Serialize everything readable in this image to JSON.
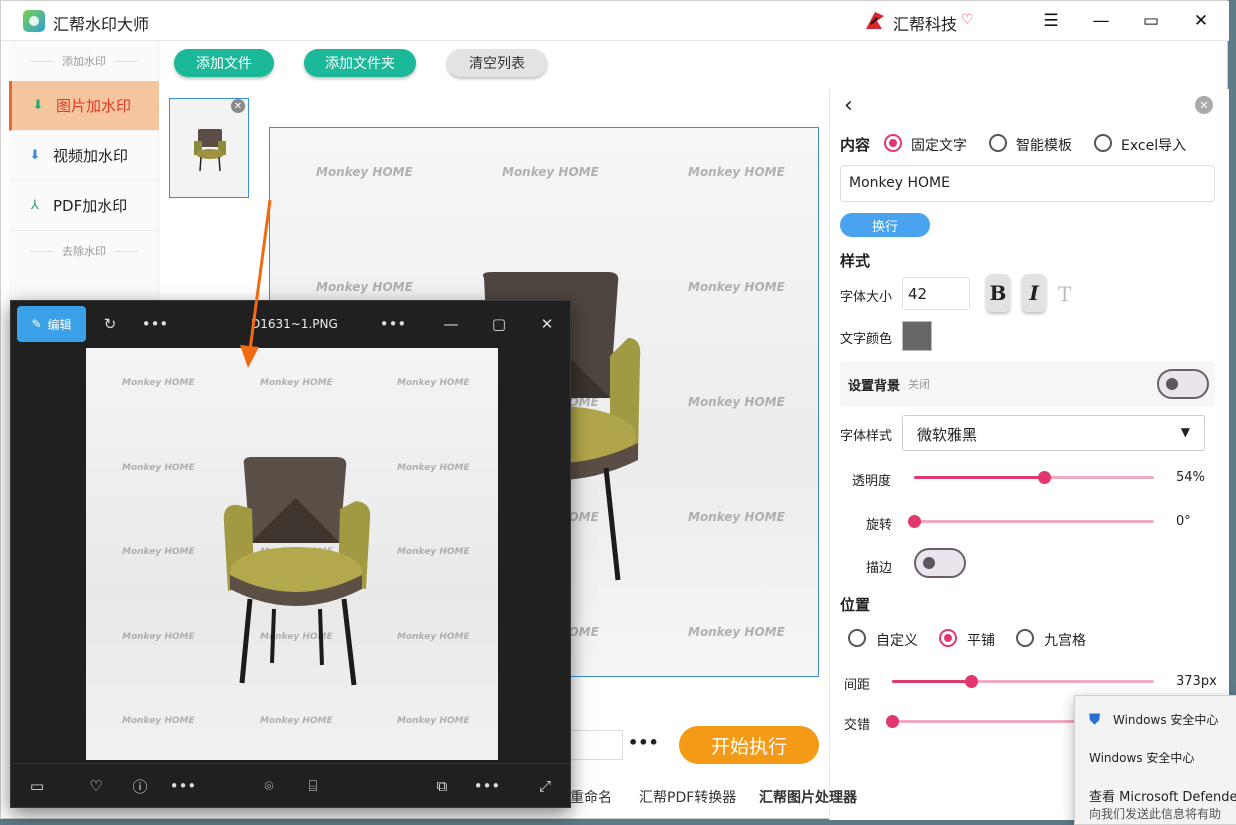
{
  "app": {
    "title": "汇帮水印大师",
    "brand": "汇帮科技"
  },
  "sidebar": {
    "section_add": "添加水印",
    "section_remove": "去除水印",
    "items": [
      {
        "label": "图片加水印",
        "icon": "download-icon"
      },
      {
        "label": "视频加水印",
        "icon": "download-icon"
      },
      {
        "label": "PDF加水印",
        "icon": "pdf-icon"
      }
    ]
  },
  "toolbar": {
    "add_file": "添加文件",
    "add_folder": "添加文件夹",
    "clear_list": "清空列表"
  },
  "watermark": {
    "text": "Monkey HOME"
  },
  "panel": {
    "content_label": "内容",
    "opt_fixed": "固定文字",
    "opt_template": "智能模板",
    "opt_excel": "Excel导入",
    "text_value": "Monkey HOME",
    "newline": "换行",
    "style_label": "样式",
    "font_size_label": "字体大小",
    "font_size": "42",
    "bold": "B",
    "italic": "I",
    "clear_fmt": "T",
    "text_color_label": "文字颜色",
    "text_color": "#666666",
    "bg_label": "设置背景",
    "bg_state": "关闭",
    "font_style_label": "字体样式",
    "font_style": "微软雅黑",
    "opacity_label": "透明度",
    "opacity": "54%",
    "opacity_value": 0.54,
    "rotate_label": "旋转",
    "rotate": "0°",
    "rotate_value": 0,
    "stroke_label": "描边",
    "position_label": "位置",
    "pos_custom": "自定义",
    "pos_tile": "平铺",
    "pos_grid": "九宫格",
    "spacing_label": "间距",
    "spacing": "373px",
    "spacing_value": 0.3,
    "stagger_label": "交错",
    "stagger_value": 0
  },
  "run_label": "开始执行",
  "bottom_links": [
    "重命名",
    "汇帮PDF转换器",
    "汇帮图片处理器"
  ],
  "viewer": {
    "edit": "编辑",
    "filename": "D1631~1.PNG"
  },
  "toast": {
    "title": "Windows 安全中心",
    "body": "Windows 安全中心",
    "line1": "查看 Microsoft Defende",
    "line2": "向我们发送此信息将有助"
  }
}
